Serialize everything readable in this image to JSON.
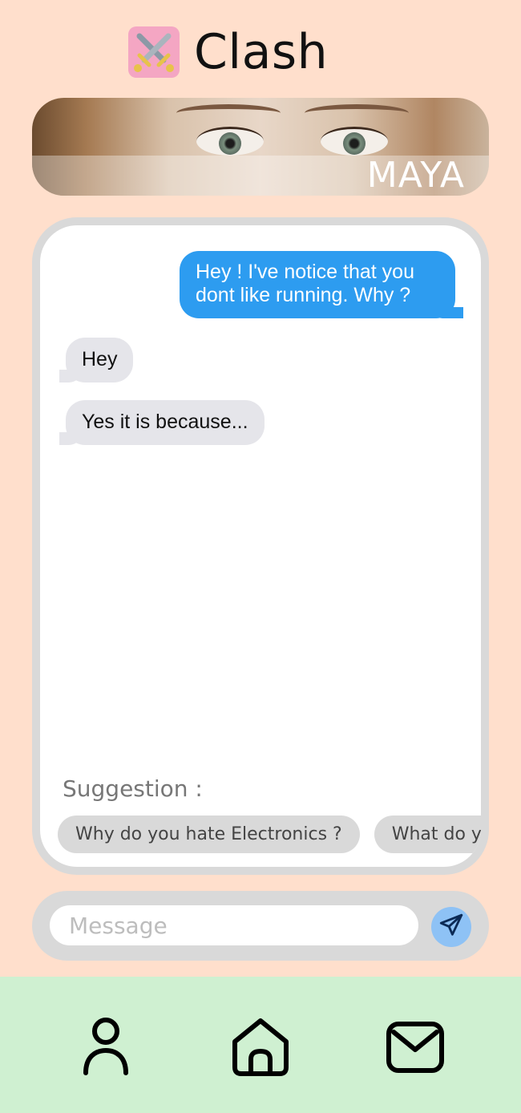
{
  "header": {
    "app_name": "Clash",
    "logo_icon": "crossed-swords-icon",
    "logo_bg": "#f4a6c3"
  },
  "profile": {
    "name": "MAYA"
  },
  "chat": {
    "messages": [
      {
        "from": "me",
        "text": "Hey ! I've notice that you dont like running. Why ?"
      },
      {
        "from": "them",
        "text": "Hey"
      },
      {
        "from": "them",
        "text": "Yes it is because..."
      }
    ],
    "suggestion_label": "Suggestion :",
    "suggestions": [
      "Why do you hate Electronics ?",
      "What do you"
    ]
  },
  "composer": {
    "value": "",
    "placeholder": "Message",
    "send_icon": "paper-plane-icon"
  },
  "nav": {
    "items": [
      {
        "icon": "user-icon"
      },
      {
        "icon": "home-icon"
      },
      {
        "icon": "mail-icon"
      }
    ]
  },
  "colors": {
    "background": "#ffdfcc",
    "outgoing_bubble": "#2d9cf0",
    "incoming_bubble": "#e5e5ea",
    "panel": "#d9d9d9",
    "nav_bg": "#cff0d1",
    "send_button": "#8ec2f5"
  }
}
